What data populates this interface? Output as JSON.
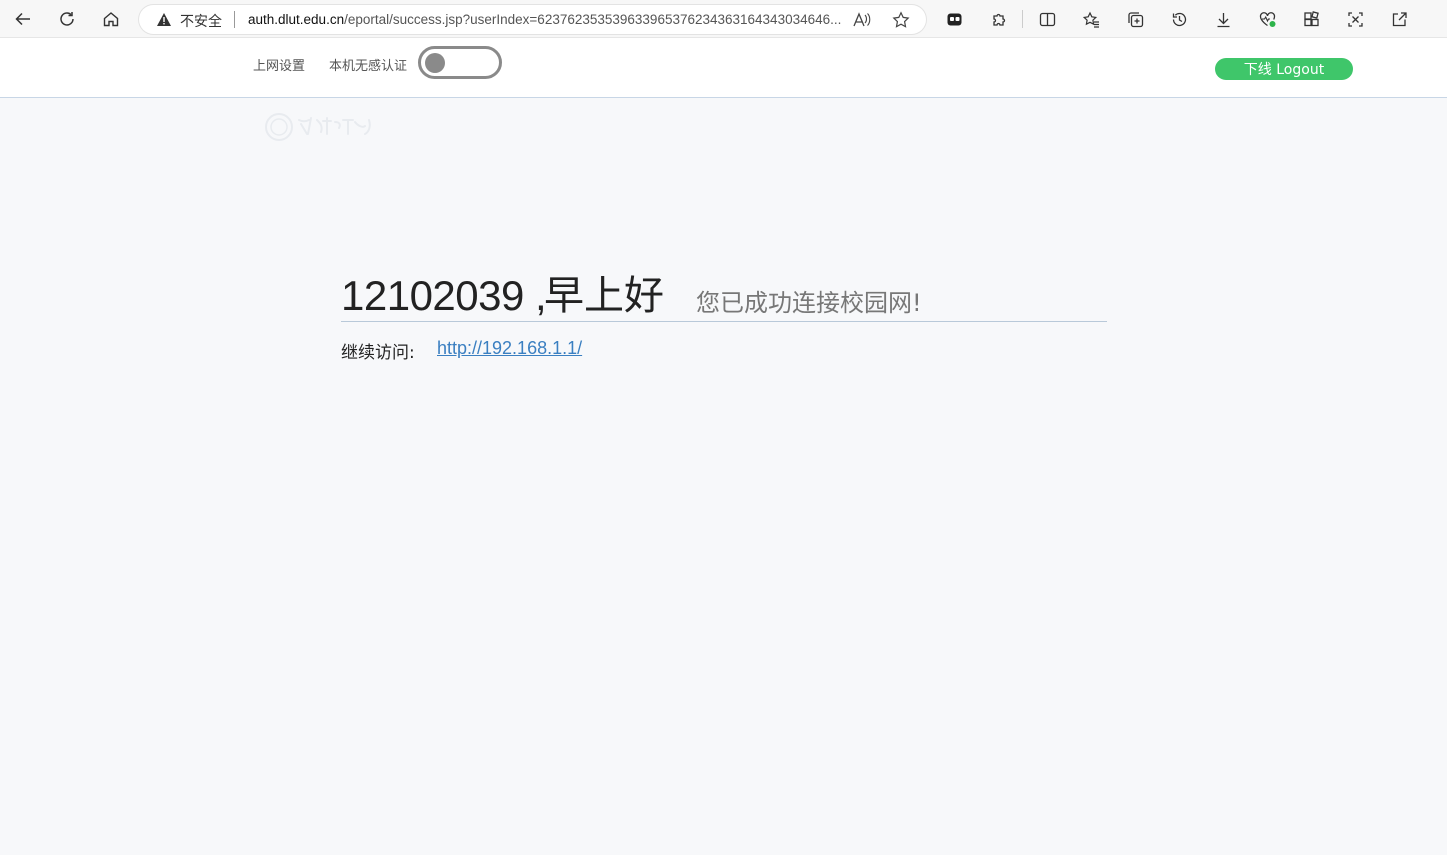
{
  "browser": {
    "security_label": "不安全",
    "url_host": "auth.dlut.edu.cn",
    "url_path": "/eportal/success.jsp?userIndex=623762353539633965376234363164343034646..."
  },
  "header": {
    "net_settings": "上网设置",
    "noauth_label": "本机无感认证",
    "noauth_enabled": false,
    "logout_label": "下线 Logout"
  },
  "main": {
    "user_id": "12102039",
    "separator": ",",
    "greeting": "早上好",
    "success_message": "您已成功连接校园网!",
    "continue_label": "继续访问:",
    "continue_url": "http://192.168.1.1/"
  },
  "colors": {
    "logout_bg": "#3fc66a",
    "link": "#3a7fc1",
    "toggle_off": "#8a8a8a"
  }
}
